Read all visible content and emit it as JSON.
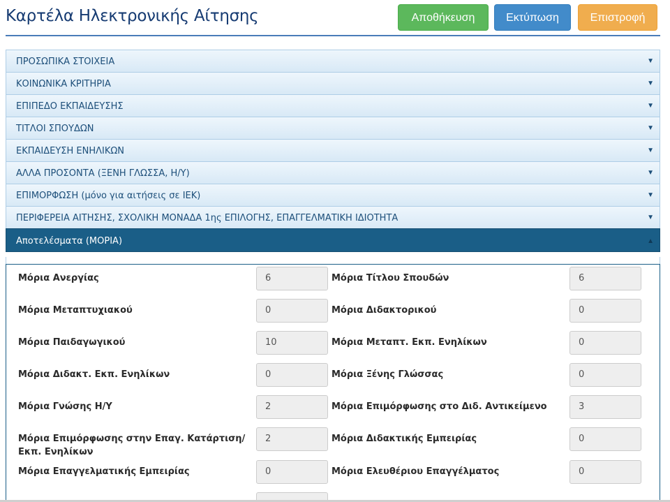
{
  "header": {
    "title": "Καρτέλα Ηλεκτρονικής Αίτησης",
    "buttons": {
      "save": "Αποθήκευση",
      "print": "Εκτύπωση",
      "back": "Επιστροφή"
    },
    "colors": {
      "save": "#5cb85c",
      "print": "#428bca",
      "back": "#f0ad4e"
    }
  },
  "accordion": {
    "sections": [
      "ΠΡΟΣΩΠΙΚΑ ΣΤΟΙΧΕΙΑ",
      "ΚΟΙΝΩΝΙΚΑ ΚΡΙΤΗΡΙΑ",
      "ΕΠΙΠΕΔΟ ΕΚΠΑΙΔΕΥΣΗΣ",
      "ΤΙΤΛΟΙ ΣΠΟΥΔΩΝ",
      "ΕΚΠΑΙΔΕΥΣΗ ΕΝΗΛΙΚΩΝ",
      "ΑΛΛΑ ΠΡΟΣΟΝΤΑ (ΞΕΝΗ ΓΛΩΣΣΑ, Η/Υ)",
      "ΕΠΙΜΟΡΦΩΣΗ (μόνο για αιτήσεις σε ΙΕΚ)",
      "ΠΕΡΙΦΕΡΕΙΑ ΑΙΤΗΣΗΣ, ΣΧΟΛΙΚΗ ΜΟΝΑΔΑ 1ης ΕΠΙΛΟΓΗΣ, ΕΠΑΓΓΕΛΜΑΤΙΚΗ ΙΔΙΟΤΗΤΑ"
    ],
    "active_section": "Αποτελέσματα (ΜΟΡΙΑ)",
    "caret_down": "▼",
    "caret_up": "▲",
    "active_color": "#1a5e87"
  },
  "results": {
    "left": [
      {
        "label": "Μόρια Ανεργίας",
        "value": "6"
      },
      {
        "label": "Μόρια Μεταπτυχιακού",
        "value": "0"
      },
      {
        "label": "Μόρια Παιδαγωγικού",
        "value": "10"
      },
      {
        "label": "Μόρια Διδακτ. Εκπ. Ενηλίκων",
        "value": "0"
      },
      {
        "label": "Μόρια Γνώσης Η/Υ",
        "value": "2"
      },
      {
        "label": "Μόρια Επιμόρφωσης στην Επαγ. Κατάρτιση/",
        "label2": "Εκπ. Ενηλίκων",
        "value": "2"
      },
      {
        "label": "Μόρια Επαγγελματικής Εμπειρίας",
        "value": "0"
      }
    ],
    "right": [
      {
        "label": "Μόρια Τίτλου Σπουδών",
        "value": "6"
      },
      {
        "label": "Μόρια Διδακτορικού",
        "value": "0"
      },
      {
        "label": "Μόρια Μεταπτ. Εκπ. Ενηλίκων",
        "value": "0"
      },
      {
        "label": "Μόρια Ξένης Γλώσσας",
        "value": "0"
      },
      {
        "label": "Μόρια Επιμόρφωσης στο Διδ. Αντικείμενο",
        "value": "3"
      },
      {
        "label": "Μόρια Διδακτικής Εμπειρίας",
        "value": "0"
      },
      {
        "label": "Μόρια Ελευθέριου Επαγγέλματος",
        "value": "0"
      }
    ]
  }
}
